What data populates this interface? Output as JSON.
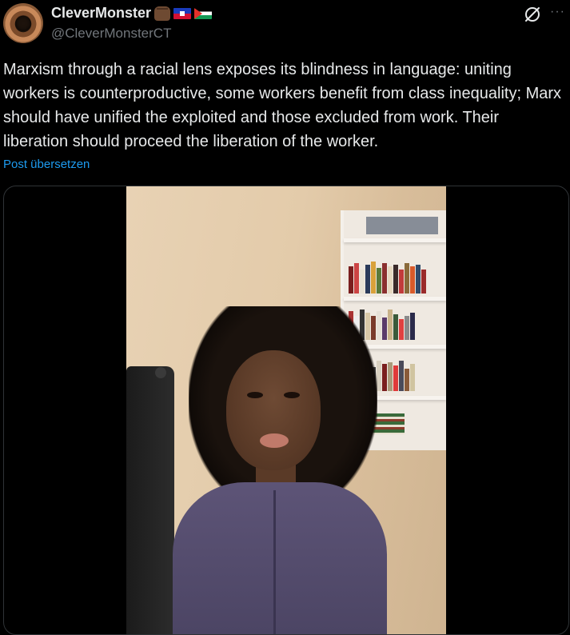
{
  "author": {
    "display_name": "CleverMonster",
    "handle": "@CleverMonsterCT",
    "badges": [
      "raised-fist-emoji",
      "haiti-flag-emoji",
      "palestine-flag-emoji"
    ]
  },
  "post": {
    "text": "Marxism through a racial lens exposes its blindness in language: uniting workers is counterproductive, some workers benefit from class inequality; Marx should have unified the exploited and those excluded from work. Their liberation should proceed the liberation of the worker.",
    "translate_label": "Post übersetzen"
  },
  "actions": {
    "more_label": "···"
  },
  "colors": {
    "background": "#000000",
    "text": "#e7e9ea",
    "secondary": "#71767b",
    "link": "#1d9bf0",
    "border": "#2f3336"
  },
  "icons": [
    "grok-icon",
    "more-icon"
  ]
}
